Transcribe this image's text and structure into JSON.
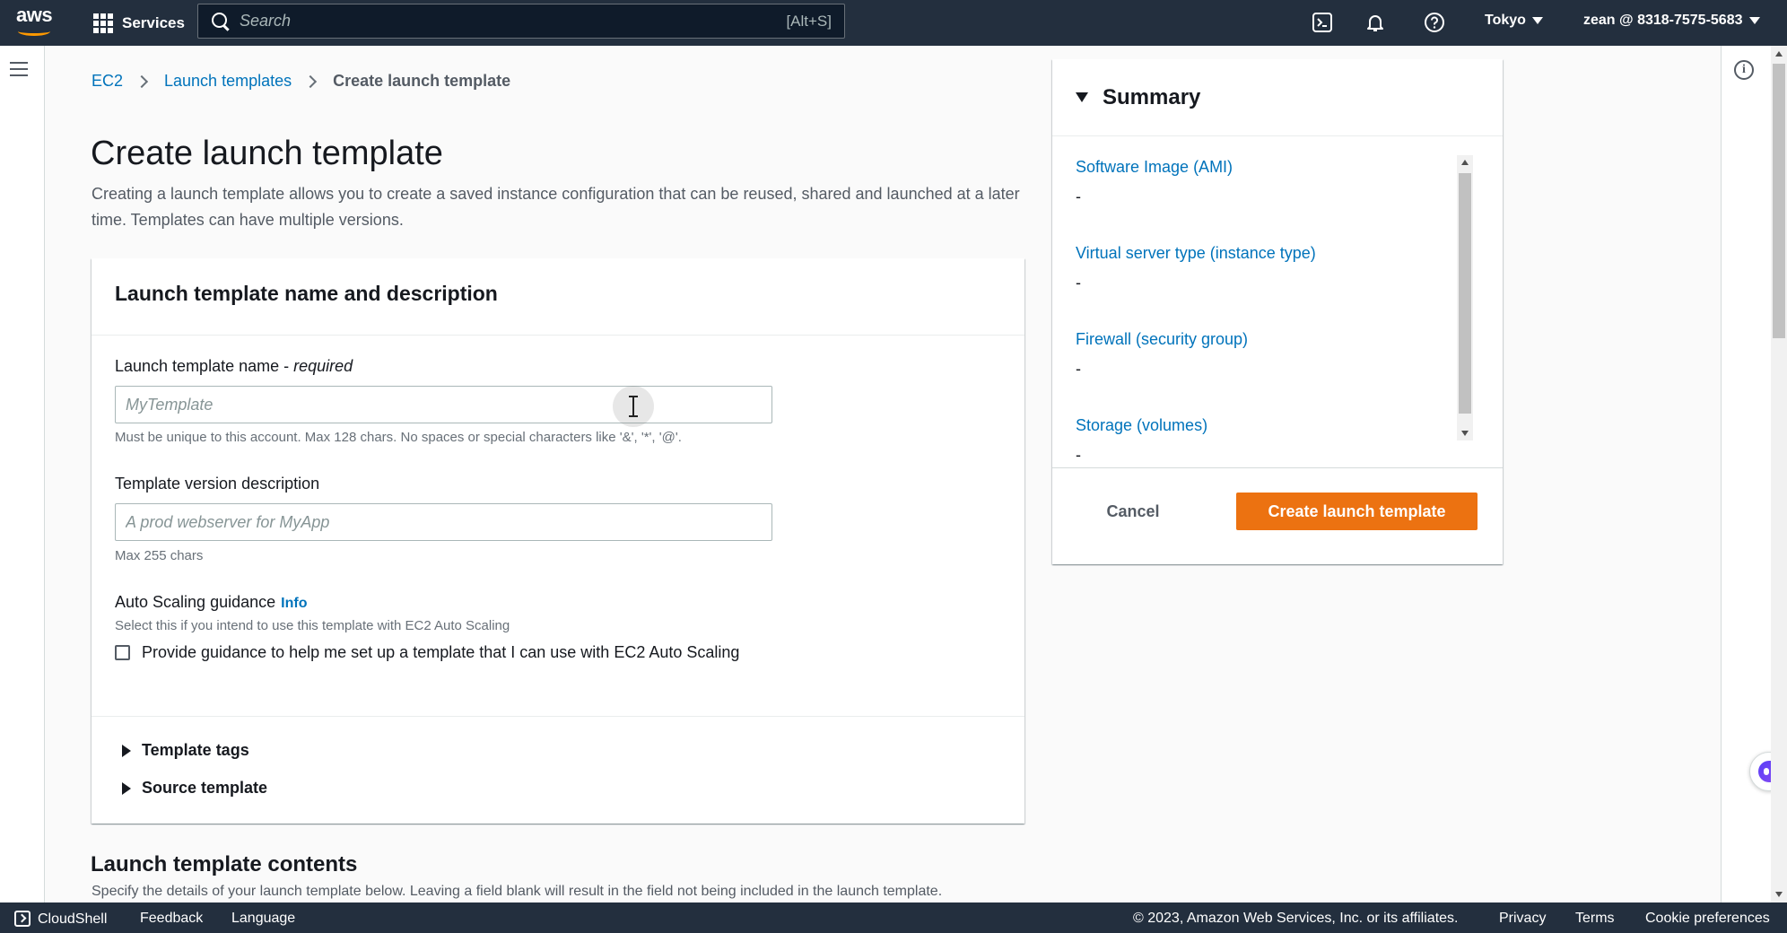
{
  "topnav": {
    "logo_text": "aws",
    "services_label": "Services",
    "search_placeholder": "Search",
    "search_hint": "[Alt+S]",
    "region": "Tokyo",
    "account": "zean @ 8318-7575-5683"
  },
  "breadcrumb": {
    "items": [
      "EC2",
      "Launch templates"
    ],
    "current": "Create launch template"
  },
  "page": {
    "title": "Create launch template",
    "description": "Creating a launch template allows you to create a saved instance configuration that can be reused, shared and launched at a later time. Templates can have multiple versions."
  },
  "form_card": {
    "header": "Launch template name and description",
    "name_label": "Launch template name - ",
    "name_required": "required",
    "name_placeholder": "MyTemplate",
    "name_constraint": "Must be unique to this account. Max 128 chars. No spaces or special characters like '&', '*', '@'.",
    "desc_label": "Template version description",
    "desc_placeholder": "A prod webserver for MyApp",
    "desc_constraint": "Max 255 chars",
    "autoscaling_label": "Auto Scaling guidance",
    "autoscaling_info": "Info",
    "autoscaling_desc": "Select this if you intend to use this template with EC2 Auto Scaling",
    "autoscaling_checkbox_label": "Provide guidance to help me set up a template that I can use with EC2 Auto Scaling",
    "expanders": [
      "Template tags",
      "Source template"
    ]
  },
  "section2": {
    "title": "Launch template contents",
    "description": "Specify the details of your launch template below. Leaving a field blank will result in the field not being included in the launch template."
  },
  "summary": {
    "title": "Summary",
    "items": [
      {
        "key": "Software Image (AMI)",
        "value": "-"
      },
      {
        "key": "Virtual server type (instance type)",
        "value": "-"
      },
      {
        "key": "Firewall (security group)",
        "value": "-"
      },
      {
        "key": "Storage (volumes)",
        "value": "-"
      }
    ],
    "cancel_label": "Cancel",
    "create_label": "Create launch template"
  },
  "footer": {
    "cloudshell": "CloudShell",
    "feedback": "Feedback",
    "language": "Language",
    "copyright": "© 2023, Amazon Web Services, Inc. or its affiliates.",
    "privacy": "Privacy",
    "terms": "Terms",
    "cookies": "Cookie preferences"
  },
  "colors": {
    "nav_bg": "#232f3e",
    "link": "#0073bb",
    "primary_button": "#ec7211",
    "logo_smile": "#ff9900"
  }
}
